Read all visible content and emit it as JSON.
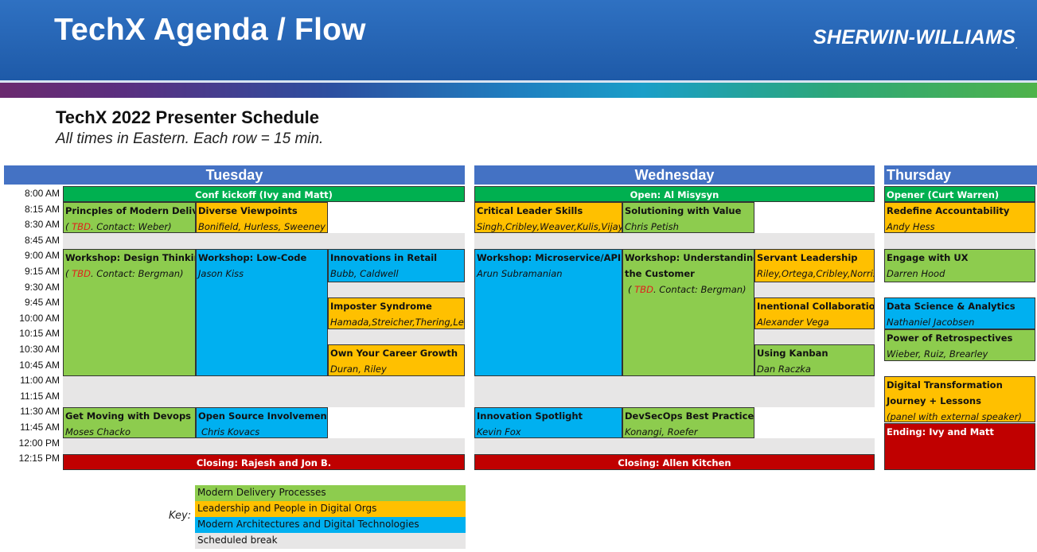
{
  "header": {
    "title": "TechX Agenda / Flow",
    "brand": "SHERWIN-WILLIAMS",
    "brand_mark": "."
  },
  "schedule": {
    "title": "TechX 2022 Presenter Schedule",
    "subtitle": "All times in Eastern. Each row = 15 min."
  },
  "days": {
    "tue": "Tuesday",
    "wed": "Wednesday",
    "thu": "Thursday"
  },
  "times": [
    "8:00 AM",
    "8:15 AM",
    "8:30 AM",
    "8:45 AM",
    "9:00 AM",
    "9:15 AM",
    "9:30 AM",
    "9:45 AM",
    "10:00 AM",
    "10:15 AM",
    "10:30 AM",
    "10:45 AM",
    "11:00 AM",
    "11:15 AM",
    "11:30 AM",
    "11:45 AM",
    "12:00 PM",
    "12:15 PM"
  ],
  "tuesday": {
    "kickoff": "Conf kickoff (Ivy and Matt)",
    "principles": {
      "title": "Princples of Modern Delivery",
      "tbd": "TBD",
      "contact": ". Contact: Weber)",
      "open": "( "
    },
    "diverse": {
      "title": "Diverse Viewpoints",
      "speaker": "Bonifield, Hurless, Sweeney"
    },
    "design": {
      "title": "Workshop: Design Thinking",
      "open": "( ",
      "tbd": "TBD",
      "contact": ". Contact: Bergman)"
    },
    "lowcode": {
      "title": "Workshop: Low-Code",
      "speaker": "Jason Kiss"
    },
    "retail": {
      "title": "Innovations in Retail",
      "speaker": "Bubb, Caldwell"
    },
    "imposter": {
      "title": "Imposter Syndrome",
      "speaker": "Hamada,Streicher,Thering,Lee"
    },
    "career": {
      "title": "Own Your Career Growth",
      "speaker": "Duran, Riley"
    },
    "devops": {
      "title": "Get Moving with Devops",
      "speaker": "Moses Chacko"
    },
    "opensource": {
      "title": "Open Source Involvement",
      "speaker": "Chris Kovacs"
    },
    "closing": "Closing: Rajesh and Jon B."
  },
  "wednesday": {
    "opener": "Open: Al Misysyn",
    "critical": {
      "title": "Critical Leader Skills",
      "speaker": "Singh,Cribley,Weaver,Kulis,Vijay"
    },
    "value": {
      "title": "Solutioning with Value",
      "speaker": "Chris Petish"
    },
    "micro": {
      "title": "Workshop: Microservice/API",
      "speaker": "Arun Subramanian"
    },
    "understand": {
      "title": "Workshop: Understanding",
      "title2": "the Customer",
      "open": "( ",
      "tbd": "TBD",
      "contact": ". Contact: Bergman)"
    },
    "servant": {
      "title": "Servant Leadership",
      "speaker": "Riley,Ortega,Cribley,Norris"
    },
    "collab": {
      "title": "Inentional Collaboration",
      "speaker": "Alexander Vega"
    },
    "kanban": {
      "title": "Using Kanban",
      "speaker": "Dan Raczka"
    },
    "spotlight": {
      "title": "Innovation Spotlight",
      "speaker": "Kevin Fox"
    },
    "devsecops": {
      "title": "DevSecOps Best Practices",
      "speaker": "Konangi, Roefer"
    },
    "closing": "Closing: Allen Kitchen"
  },
  "thursday": {
    "opener": "Opener (Curt Warren)",
    "account": {
      "title": "Redefine Accountability",
      "speaker": "Andy Hess"
    },
    "ux": {
      "title": "Engage with UX",
      "speaker": "Darren Hood"
    },
    "data": {
      "title": "Data Science & Analytics",
      "speaker": "Nathaniel Jacobsen"
    },
    "retro": {
      "title": "Power of Retrospectives",
      "speaker": "Wieber, Ruiz, Brearley"
    },
    "digital": {
      "title": "Digital Transformation",
      "title2": "Journey + Lessons",
      "speaker": "(panel with external speaker)"
    },
    "ending": "Ending: Ivy and Matt"
  },
  "key": {
    "label": "Key:",
    "items": [
      "Modern Delivery Processes",
      "Leadership and People in Digital Orgs",
      "Modern Architectures and Digital Technologies",
      "Scheduled break"
    ]
  },
  "colors": {
    "green": "#8dcc4e",
    "yellow": "#ffc000",
    "blue": "#00b0f0",
    "break": "#e7e6e6",
    "header": "#4472c4",
    "closing": "#c00000",
    "opener": "#00b050"
  }
}
